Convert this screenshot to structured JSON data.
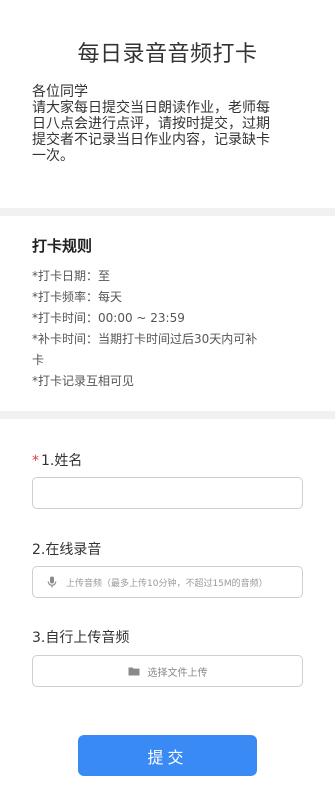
{
  "page": {
    "title": "每日录音音频打卡"
  },
  "intro": {
    "greeting": "各位同学",
    "lines": [
      "请大家每日提交当日朗读作业，老师每",
      "日八点会进行点评，请按时提交，过期",
      "提交者不记录当日作业内容，记录缺卡",
      "一次。"
    ]
  },
  "rules": {
    "title": "打卡规则",
    "items": [
      "*打卡日期：至",
      "*打卡频率：每天",
      "*打卡时间：00:00 ~ 23:59",
      "*补卡时间：当期打卡时间过后30天内可补",
      "卡",
      "*打卡记录互相可见"
    ]
  },
  "form": {
    "q1": {
      "required_mark": "*",
      "label": "1.姓名",
      "value": ""
    },
    "q2": {
      "label": "2.在线录音",
      "hint": "上传音频（最多上传10分钟，不超过15M的音频）",
      "icon": "microphone-icon"
    },
    "q3": {
      "label": "3.自行上传音频",
      "button_text": "选择文件上传",
      "icon": "folder-icon"
    },
    "submit_label": "提交"
  },
  "colors": {
    "accent": "#3a8af5",
    "required": "#e03b3b",
    "divider": "#f1f1f1"
  }
}
